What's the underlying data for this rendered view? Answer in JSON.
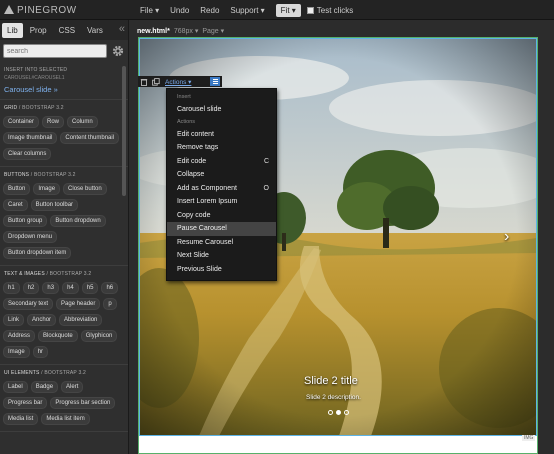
{
  "app": {
    "logo_text": "PINEGROW",
    "menu": [
      "File ▾",
      "Undo",
      "Redo",
      "Support ▾"
    ],
    "fit_label": "Fit ▾",
    "test_clicks_label": "Test clicks"
  },
  "panel": {
    "tabs": [
      "Lib",
      "Prop",
      "CSS",
      "Vars"
    ],
    "active_tab": "Lib",
    "collapse_symbol": "«",
    "search_placeholder": "search",
    "insert_heading": "INSERT INTO SELECTED",
    "insert_sub": "CAROUSEL#CAROUSEL1",
    "insert_link": "Carousel slide »",
    "sections": [
      {
        "title": "GRID",
        "source": "/ BOOTSTRAP 3.2",
        "items": [
          "Container",
          "Row",
          "Column",
          "Image thumbnail",
          "Content thumbnail",
          "Clear columns"
        ]
      },
      {
        "title": "BUTTONS",
        "source": "/ BOOTSTRAP 3.2",
        "items": [
          "Button",
          "Image",
          "Close button",
          "Caret",
          "Button toolbar",
          "Button group",
          "Button dropdown",
          "Dropdown menu",
          "Button dropdown item"
        ]
      },
      {
        "title": "TEXT & IMAGES",
        "source": "/ BOOTSTRAP 3.2",
        "items": [
          "h1",
          "h2",
          "h3",
          "h4",
          "h5",
          "h6",
          "Secondary text",
          "Page header",
          "p",
          "Link",
          "Anchor",
          "Abbreviation",
          "Address",
          "Blockquote",
          "Glyphicon",
          "Image",
          "hr"
        ]
      },
      {
        "title": "UI ELEMENTS",
        "source": "/ BOOTSTRAP 3.2",
        "items": [
          "Label",
          "Badge",
          "Alert",
          "Progress bar",
          "Progress bar section",
          "Media list",
          "Media list item"
        ]
      }
    ]
  },
  "canvas": {
    "file_name": "new.html",
    "modified_mark": "*",
    "width_label": "768px ▾",
    "page_label": "Page ▾",
    "caption_title": "Slide 2 title",
    "caption_desc": "Slide 2 description.",
    "active_dot": 1,
    "dot_count": 3,
    "next_symbol": "›",
    "size_tag": "IMG"
  },
  "selection_toolbar": {
    "actions_label": "Actions ▾"
  },
  "context_menu": {
    "groups": [
      {
        "header": "Insert",
        "items": [
          {
            "label": "Carousel slide",
            "shortcut": ""
          }
        ]
      },
      {
        "header": "Actions",
        "items": [
          {
            "label": "Edit content",
            "shortcut": ""
          },
          {
            "label": "Remove tags",
            "shortcut": ""
          },
          {
            "label": "Edit code",
            "shortcut": "C"
          },
          {
            "label": "Collapse",
            "shortcut": ""
          },
          {
            "label": "Add as Component",
            "shortcut": "O"
          },
          {
            "label": "Insert Lorem Ipsum",
            "shortcut": ""
          },
          {
            "label": "Copy code",
            "shortcut": ""
          },
          {
            "label": "Pause Carousel",
            "shortcut": ""
          },
          {
            "label": "Resume Carousel",
            "shortcut": ""
          },
          {
            "label": "Next Slide",
            "shortcut": ""
          },
          {
            "label": "Previous Slide",
            "shortcut": ""
          }
        ]
      }
    ],
    "highlighted": "Pause Carousel"
  },
  "colors": {
    "accent_blue": "#78a9ea",
    "selection_green": "#57b06a",
    "menu_bg": "#1b1b1b"
  }
}
